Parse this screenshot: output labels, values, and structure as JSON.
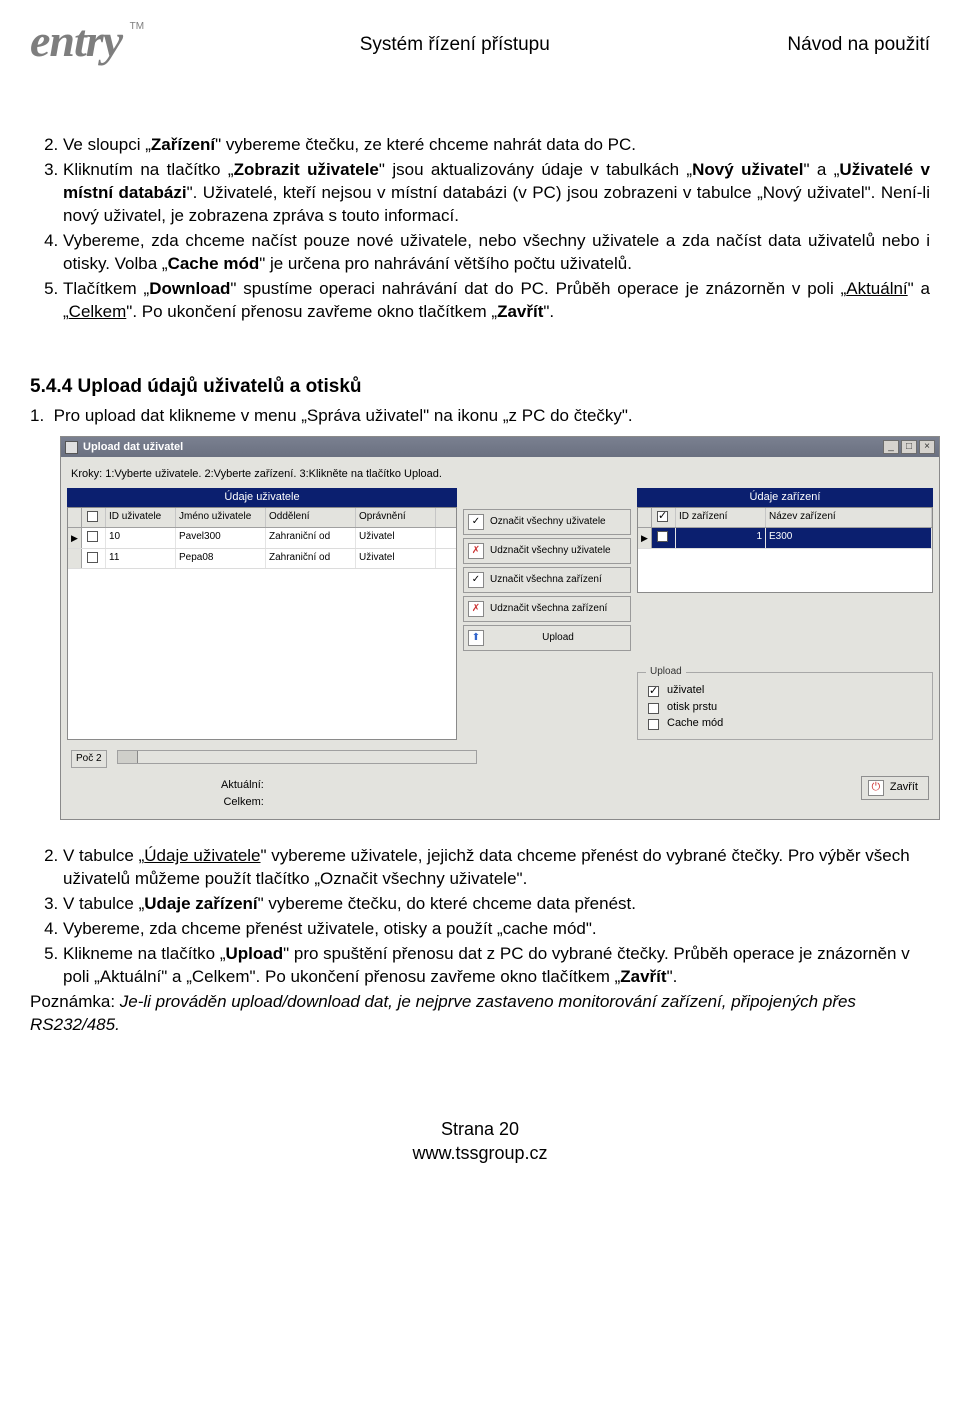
{
  "header": {
    "logo_text": "entry",
    "logo_tm": "TM",
    "center": "Systém řízení přístupu",
    "right": "Návod na použití"
  },
  "list1": {
    "start": 2,
    "items": [
      {
        "pre": "Ve sloupci „",
        "b": "Zařízení",
        "post": "\" vybereme čtečku, ze které chceme nahrát data do PC."
      },
      {
        "pre": "Kliknutím na tlačítko „",
        "b": "Zobrazit uživatele",
        "post": "\" jsou aktualizovány údaje v tabulkách „",
        "b2": "Nový uživatel",
        "post2": "\" a „",
        "b3": "Uživatelé v místní databázi",
        "post3": "\". Uživatelé, kteří nejsou v místní databázi (v PC) jsou zobrazeni v tabulce „Nový uživatel\". Není-li nový uživatel, je zobrazena zpráva s touto informací."
      },
      {
        "pre": "Vybereme, zda chceme načíst pouze nové uživatele, nebo všechny uživatele a zda načíst data uživatelů nebo i otisky. Volba „",
        "b": "Cache mód",
        "post": "\" je určena pro nahrávání většího počtu uživatelů."
      },
      {
        "pre": "Tlačítkem „",
        "b": "Download",
        "post": "\" spustíme operaci nahrávání dat do PC. Průběh operace je znázorněn v poli „",
        "u1": "Aktuální",
        "mid": "\" a „",
        "u2": "Celkem",
        "post2": "\". Po ukončení přenosu zavřeme okno tlačítkem „",
        "b2": "Zavřít",
        "post3": "\"."
      }
    ]
  },
  "section": "5.4.4  Upload údajů uživatelů a otisků",
  "list2_pre": {
    "num": "1.",
    "text": "Pro upload dat klikneme v menu „Správa uživatel\" na ikonu „z PC do čtečky\"."
  },
  "win": {
    "title": "Upload dat uživatel",
    "kroky": "Kroky: 1:Vyberte uživatele. 2:Vyberte zařízení. 3:Klikněte na tlačítko Upload.",
    "left_title": "Údaje uživatele",
    "right_title": "Údaje zařízení",
    "left_headers": [
      "ID uživatele",
      "Jméno uživatele",
      "Oddělení",
      "Oprávnění"
    ],
    "left_rows": [
      {
        "id": "10",
        "name": "Pavel300",
        "dept": "Zahraniční od",
        "perm": "Uživatel"
      },
      {
        "id": "11",
        "name": "Pepa08",
        "dept": "Zahraniční od",
        "perm": "Uživatel"
      }
    ],
    "right_headers": [
      "ID zařízení",
      "Název zařízení"
    ],
    "right_rows": [
      {
        "id": "1",
        "name": "E300"
      }
    ],
    "mid_buttons": [
      {
        "icon": "✓",
        "label": "Označit všechny uživatele"
      },
      {
        "icon": "✗",
        "label": "Udznačit všechny uživatele"
      },
      {
        "icon": "✓",
        "label": "Uznačit všechna zařízení"
      },
      {
        "icon": "✗",
        "label": "Udznačit všechna zařízení"
      },
      {
        "icon": "⬆",
        "label": "Upload"
      }
    ],
    "upload_box_title": "Upload",
    "upload_checks": [
      {
        "label": "uživatel",
        "checked": true
      },
      {
        "label": "otisk prstu",
        "checked": false
      },
      {
        "label": "Cache mód",
        "checked": false
      }
    ],
    "poc_label": "Poč",
    "poc_val": "2",
    "aktualni": "Aktuální:",
    "celkem": "Celkem:",
    "close": "Zavřít"
  },
  "list3": {
    "start": 2,
    "items": [
      "V tabulce „Údaje uživatele\" vybereme uživatele, jejichž data chceme přenést do vybrané čtečky. Pro výběr všech uživatelů můžeme použít tlačítko „Označit všechny uživatele\".",
      "V tabulce „Udaje zařízení\" vybereme čtečku, do které chceme data přenést.",
      "Vybereme, zda chceme přenést uživatele, otisky a použít „cache mód\".",
      "Klikneme na tlačítko „Upload\" pro spuštění přenosu dat z PC do vybrané čtečky. Průběh operace je znázorněn v poli „Aktuální\" a „Celkem\". Po ukončení přenosu zavřeme okno tlačítkem „Zavřít\"."
    ]
  },
  "list3_u1": "Údaje uživatele",
  "list3_b1": "Udaje zařízení",
  "list3_b2": "Upload",
  "list3_b3": "Zavřít",
  "note": {
    "pre": "Poznámka: ",
    "it": "Je-li prováděn upload/download dat, je nejprve zastaveno monitorování zařízení, připojených přes RS232/485."
  },
  "footer": {
    "page": "Strana 20",
    "url": "www.tssgroup.cz"
  }
}
